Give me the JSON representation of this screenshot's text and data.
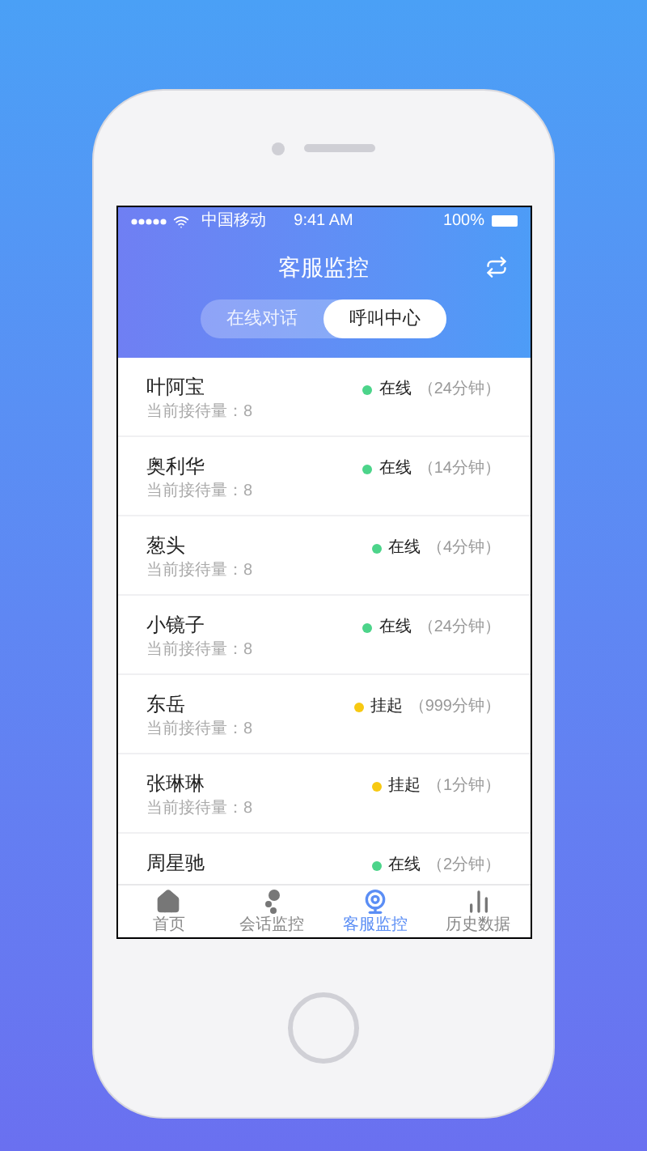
{
  "status_bar": {
    "carrier": "中国移动",
    "time": "9:41 AM",
    "battery": "100%"
  },
  "header": {
    "title": "客服监控"
  },
  "tabs": [
    {
      "label": "在线对话",
      "selected": false
    },
    {
      "label": "呼叫中心",
      "selected": true
    }
  ],
  "agents": [
    {
      "name": "叶阿宝",
      "load": "当前接待量：8",
      "status": "在线",
      "duration": "（24分钟）",
      "color": "#4cd48a"
    },
    {
      "name": "奥利华",
      "load": "当前接待量：8",
      "status": "在线",
      "duration": "（14分钟）",
      "color": "#4cd48a"
    },
    {
      "name": "葱头",
      "load": "当前接待量：8",
      "status": "在线",
      "duration": "（4分钟）",
      "color": "#4cd48a"
    },
    {
      "name": "小镜子",
      "load": "当前接待量：8",
      "status": "在线",
      "duration": "（24分钟）",
      "color": "#4cd48a"
    },
    {
      "name": "东岳",
      "load": "当前接待量：8",
      "status": "挂起",
      "duration": "（999分钟）",
      "color": "#f7c912"
    },
    {
      "name": "张琳琳",
      "load": "当前接待量：8",
      "status": "挂起",
      "duration": "（1分钟）",
      "color": "#f7c912"
    },
    {
      "name": "周星驰",
      "status": "在线",
      "duration": "（2分钟）",
      "color": "#4cd48a"
    }
  ],
  "nav": [
    {
      "kind": "home",
      "label": "首页",
      "selected": false
    },
    {
      "kind": "chat",
      "label": "会话监控",
      "selected": false
    },
    {
      "kind": "monitor",
      "label": "客服监控",
      "selected": true
    },
    {
      "kind": "history",
      "label": "历史数据",
      "selected": false
    }
  ]
}
